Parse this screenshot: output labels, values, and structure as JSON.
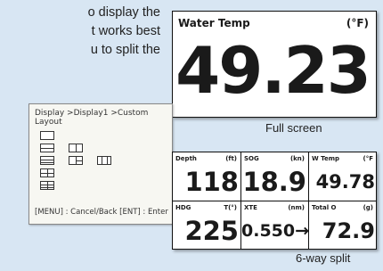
{
  "intro_text": {
    "line1": "o display the",
    "line2": "t works best",
    "line3": "u to split the"
  },
  "fullscreen_card": {
    "label": "Water Temp",
    "unit": "(°F)",
    "value": "49.23",
    "caption": "Full screen"
  },
  "custom_layout_screen": {
    "breadcrumb": "Display >Display1 >Custom Layout",
    "footer": "[MENU] : Cancel/Back   [ENT] : Enter"
  },
  "split_card": {
    "caption": "6-way split",
    "cells": [
      {
        "label": "Depth",
        "unit": "(ft)",
        "value": "118"
      },
      {
        "label": "SOG",
        "unit": "(kn)",
        "value": "18.9"
      },
      {
        "label": "W Temp",
        "unit": "(°F",
        "value": "49.78"
      },
      {
        "label": "HDG",
        "unit": "T(°)",
        "value": "225"
      },
      {
        "label": "XTE",
        "unit": "(nm)",
        "value": "0.550→"
      },
      {
        "label": "Total O",
        "unit": "(g)",
        "value": "72.9"
      }
    ]
  }
}
